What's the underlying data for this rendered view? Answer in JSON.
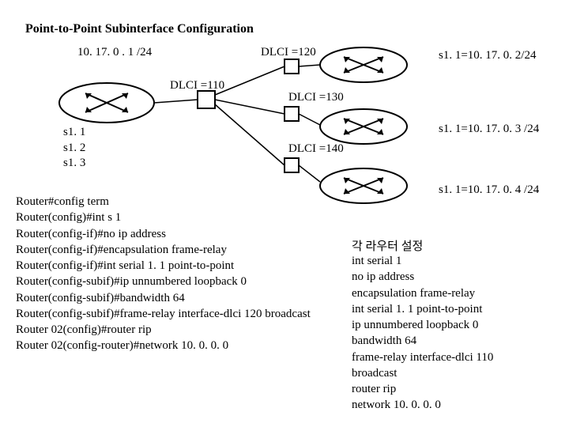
{
  "title": "Point-to-Point Subinterface Configuration",
  "main_router": {
    "network": "10. 17. 0 . 1 /24",
    "subif_list": "s1. 1\ns1. 2\ns1. 3"
  },
  "dlci": {
    "d110": "DLCI =110",
    "d120": "DLCI =120",
    "d130": "DLCI =130",
    "d140": "DLCI =140"
  },
  "remote": {
    "r1": "s1. 1=10. 17. 0. 2/24",
    "r2": "s1. 1=10. 17. 0. 3 /24",
    "r3": "s1. 1=10. 17. 0. 4 /24"
  },
  "left_config": "Router#config term\nRouter(config)#int s 1\nRouter(config-if)#no ip address\nRouter(config-if)#encapsulation frame-relay\nRouter(config-if)#int serial 1. 1 point-to-point\nRouter(config-subif)#ip unnumbered loopback 0\nRouter(config-subif)#bandwidth 64\nRouter(config-subif)#frame-relay interface-dlci 120 broadcast\nRouter 02(config)#router rip\nRouter 02(config-router)#network 10. 0. 0. 0",
  "right_config_title": "각 라우터 설정",
  "right_config": "int serial 1\nno ip address\nencapsulation frame-relay\nint serial 1. 1 point-to-point\nip unnumbered loopback 0\nbandwidth 64\nframe-relay interface-dlci 110\nbroadcast\nrouter rip\nnetwork 10. 0. 0. 0"
}
